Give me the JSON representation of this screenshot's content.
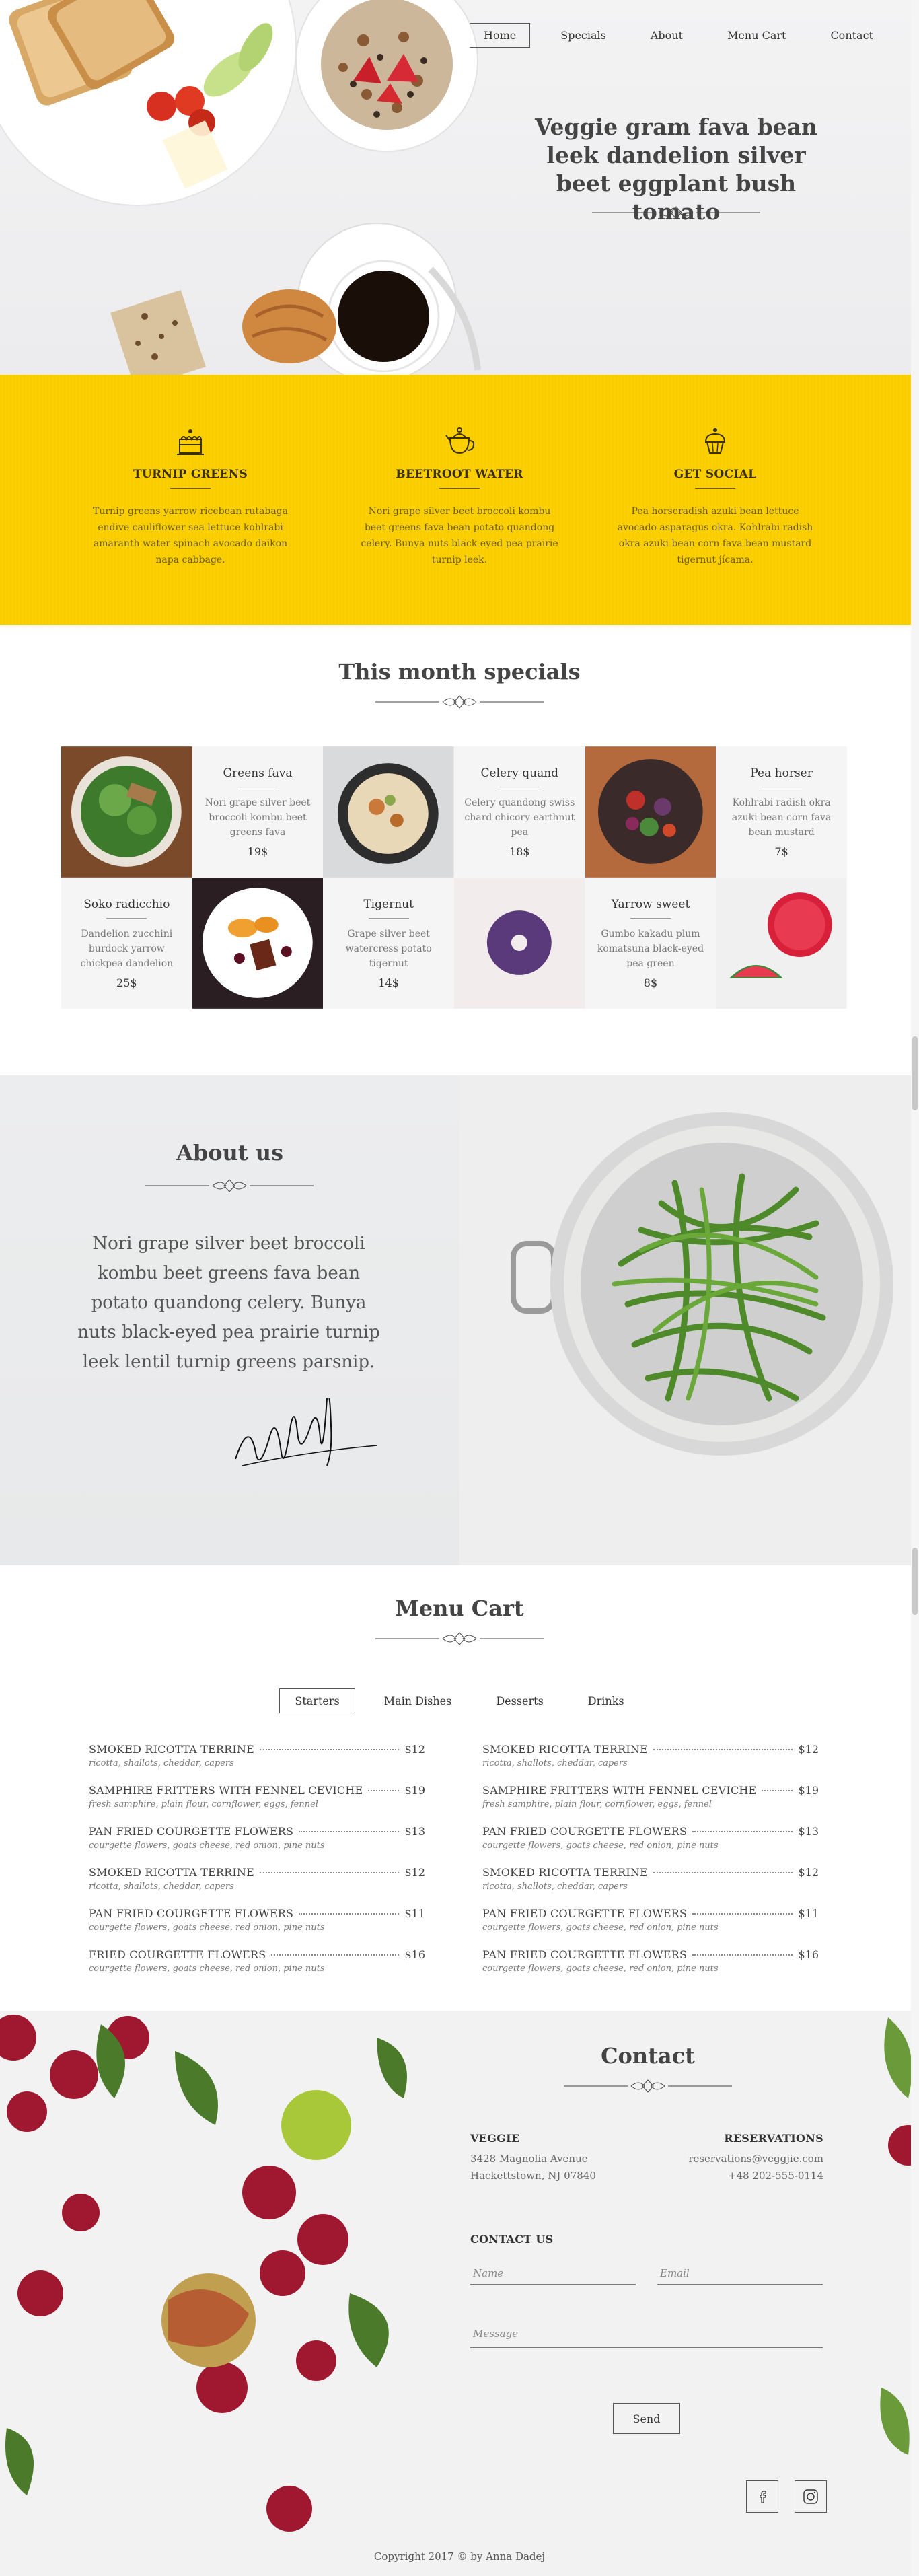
{
  "nav": {
    "items": [
      "Home",
      "Specials",
      "About",
      "Menu Cart",
      "Contact"
    ],
    "active": "Home"
  },
  "hero": {
    "title": "Veggie gram fava bean leek dandelion silver beet eggplant bush tomato"
  },
  "features": [
    {
      "icon": "cake-icon",
      "title": "TURNIP GREENS",
      "text": "Turnip greens yarrow ricebean rutabaga endive cauliflower sea lettuce kohlrabi amaranth water spinach avocado daikon napa cabbage."
    },
    {
      "icon": "teapot-icon",
      "title": "BEETROOT WATER",
      "text": "Nori grape silver beet broccoli kombu beet greens fava bean potato quandong celery. Bunya nuts black-eyed pea prairie turnip leek."
    },
    {
      "icon": "cupcake-icon",
      "title": "GET SOCIAL",
      "text": "Pea horseradish azuki bean lettuce avocado asparagus okra. Kohlrabi radish okra azuki bean corn fava bean mustard tigernut jícama."
    }
  ],
  "specials": {
    "title": "This month specials",
    "items": [
      {
        "name": "Greens fava",
        "desc": "Nori grape silver beet broccoli kombu beet greens fava",
        "price": "19$"
      },
      {
        "name": "Celery quand",
        "desc": "Celery quandong swiss chard chicory earthnut pea",
        "price": "18$"
      },
      {
        "name": "Pea horser",
        "desc": "Kohlrabi radish okra azuki bean corn fava bean mustard",
        "price": "7$"
      },
      {
        "name": "Soko radicchio",
        "desc": "Dandelion zucchini burdock yarrow chickpea dandelion",
        "price": "25$"
      },
      {
        "name": "Tigernut",
        "desc": "Grape silver beet watercress potato tigernut",
        "price": "14$"
      },
      {
        "name": "Yarrow sweet",
        "desc": "Gumbo kakadu plum komatsuna black-eyed pea green",
        "price": "8$"
      }
    ]
  },
  "about": {
    "title": "About us",
    "text": "Nori grape silver beet broccoli kombu beet greens fava bean potato quandong celery. Bunya nuts black-eyed pea prairie turnip leek lentil turnip greens parsnip."
  },
  "menu": {
    "title": "Menu Cart",
    "tabs": [
      "Starters",
      "Main Dishes",
      "Desserts",
      "Drinks"
    ],
    "active_tab": "Starters",
    "left": [
      {
        "name": "SMOKED RICOTTA TERRINE",
        "price": "$12",
        "sub": "ricotta, shallots, cheddar, capers"
      },
      {
        "name": "SAMPHIRE FRITTERS WITH FENNEL CEVICHE",
        "price": "$19",
        "sub": "fresh samphire, plain flour, cornflower, eggs, fennel"
      },
      {
        "name": "PAN FRIED COURGETTE FLOWERS",
        "price": "$13",
        "sub": "courgette flowers, goats cheese, red onion, pine nuts"
      },
      {
        "name": "SMOKED RICOTTA TERRINE",
        "price": "$12",
        "sub": "ricotta, shallots, cheddar, capers"
      },
      {
        "name": "PAN FRIED COURGETTE FLOWERS",
        "price": "$11",
        "sub": "courgette flowers, goats cheese, red onion, pine nuts"
      },
      {
        "name": "FRIED COURGETTE FLOWERS",
        "price": "$16",
        "sub": "courgette flowers, goats cheese, red onion, pine nuts"
      }
    ],
    "right": [
      {
        "name": "SMOKED RICOTTA TERRINE",
        "price": "$12",
        "sub": "ricotta, shallots, cheddar, capers"
      },
      {
        "name": "SAMPHIRE FRITTERS WITH FENNEL CEVICHE",
        "price": "$19",
        "sub": "fresh samphire, plain flour, cornflower, eggs, fennel"
      },
      {
        "name": "PAN FRIED COURGETTE FLOWERS",
        "price": "$13",
        "sub": "courgette flowers, goats cheese, red onion, pine nuts"
      },
      {
        "name": "SMOKED RICOTTA TERRINE",
        "price": "$12",
        "sub": "ricotta, shallots, cheddar, capers"
      },
      {
        "name": "PAN FRIED COURGETTE FLOWERS",
        "price": "$11",
        "sub": "courgette flowers, goats cheese, red onion, pine nuts"
      },
      {
        "name": "PAN FRIED COURGETTE FLOWERS",
        "price": "$16",
        "sub": "courgette flowers, goats cheese, red onion, pine nuts"
      }
    ]
  },
  "contact": {
    "title": "Contact",
    "veggie_head": "VEGGIE",
    "address1": "3428 Magnolia Avenue",
    "address2": "Hackettstown, NJ 07840",
    "reservations_head": "RESERVATIONS",
    "email": "reservations@veggjie.com",
    "phone": "+48 202-555-0114",
    "contact_us_head": "CONTACT US",
    "name_placeholder": "Name",
    "email_placeholder": "Email",
    "message_placeholder": "Message",
    "send_label": "Send",
    "social": [
      "facebook-icon",
      "instagram-icon"
    ]
  },
  "footer": {
    "copyright": "Copyright 2017 © by Anna Dadej"
  },
  "colors": {
    "accent_yellow": "#fcd000",
    "text_dark": "#444444"
  }
}
